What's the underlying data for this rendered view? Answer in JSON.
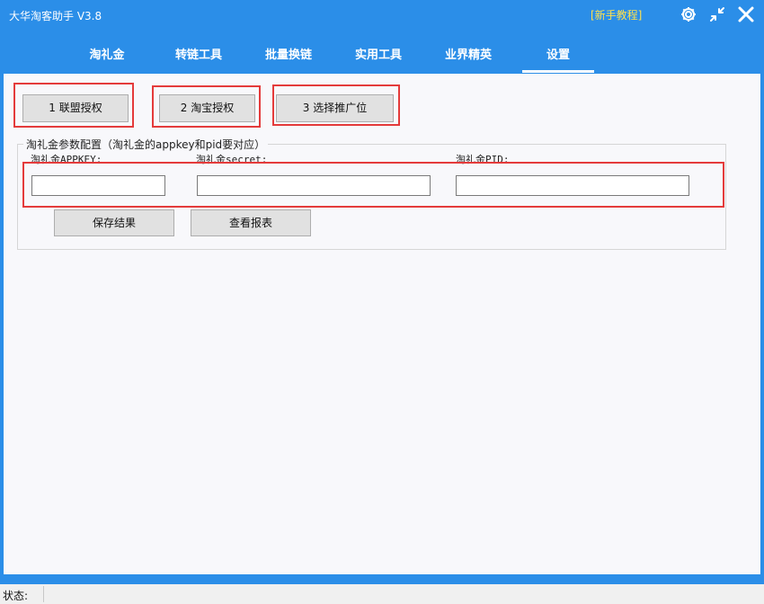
{
  "app": {
    "title": "大华淘客助手 V3.8",
    "tutorial_link": "[新手教程]"
  },
  "titlebar_icons": [
    "settings-gear-icon",
    "shrink-arrows-icon",
    "close-x-icon"
  ],
  "tabs": [
    {
      "label": "淘礼金"
    },
    {
      "label": "转链工具"
    },
    {
      "label": "批量换链"
    },
    {
      "label": "实用工具"
    },
    {
      "label": "业界精英"
    },
    {
      "label": "设置",
      "active": true
    }
  ],
  "auth_buttons": {
    "alliance": "1 联盟授权",
    "taobao": "2 淘宝授权",
    "promo": "3 选择推广位"
  },
  "config_group": {
    "legend": "淘礼金参数配置（淘礼金的appkey和pid要对应）",
    "appkey_label": "淘礼金APPKEY:",
    "appkey_value": "",
    "secret_label": "淘礼金secret:",
    "secret_value": "",
    "pid_label": "淘礼金PID:",
    "pid_value": "",
    "save_button": "保存结果",
    "report_button": "查看报表"
  },
  "status": {
    "label": "状态:"
  },
  "colors": {
    "titlebar_blue": "#2b8ee8",
    "highlight_red": "#e43b3b",
    "tutorial_yellow": "#ffe14d"
  }
}
